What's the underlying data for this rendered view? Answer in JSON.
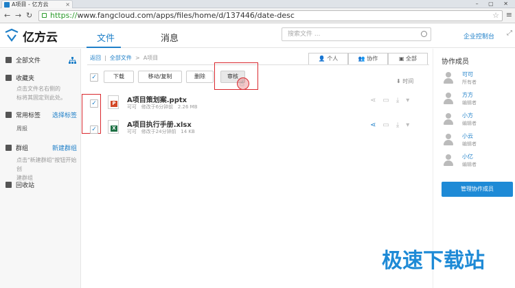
{
  "browser": {
    "tab_title": "A项目 - 亿方云",
    "url_scheme": "https://",
    "url_rest": "www.fangcloud.com/apps/files/home/d/137446/date-desc"
  },
  "header": {
    "logo_text": "亿方云",
    "nav": [
      "文件",
      "消息"
    ],
    "search_placeholder": "搜索文件 ...",
    "console_link": "企业控制台"
  },
  "sidebar": {
    "all_files": "全部文件",
    "favorites": "收藏夹",
    "favorites_hint_1": "点击文件名右侧的",
    "favorites_hint_2": "标将其固定到此处。",
    "tags": "常用标签",
    "select_tags": "选择标签",
    "tag_item": "周报",
    "groups": "群组",
    "new_group": "新建群组",
    "groups_hint_1": "点击\"新建群组\"按钮开始创",
    "groups_hint_2": "建群组",
    "trash": "回收站"
  },
  "breadcrumb": {
    "items": [
      "返回",
      "全部文件",
      "A项目"
    ]
  },
  "view_tabs": [
    "个人",
    "协作",
    "全部"
  ],
  "toolbar": {
    "download": "下载",
    "move_copy": "移动/复制",
    "delete": "删除",
    "review": "审核",
    "sort": "时间"
  },
  "files": [
    {
      "name": "A项目策划案.pptx",
      "owner": "可可",
      "modified": "修改于6分钟前",
      "size": "2.26 MB",
      "type": "P",
      "color": "#d24726"
    },
    {
      "name": "A项目执行手册.xlsx",
      "owner": "可可",
      "modified": "修改于24分钟前",
      "size": "14 KB",
      "type": "X",
      "color": "#1e7145"
    }
  ],
  "collaborators": {
    "title": "协作成员",
    "members": [
      {
        "name": "可可",
        "role": "所有者"
      },
      {
        "name": "方方",
        "role": "编辑者"
      },
      {
        "name": "小方",
        "role": "编辑者"
      },
      {
        "name": "小云",
        "role": "编辑者"
      },
      {
        "name": "小亿",
        "role": "编辑者"
      }
    ],
    "manage_button": "管理协作成员"
  },
  "watermark": "极速下载站",
  "colors": {
    "accent": "#1e7fc8",
    "highlight": "#d9262c"
  }
}
